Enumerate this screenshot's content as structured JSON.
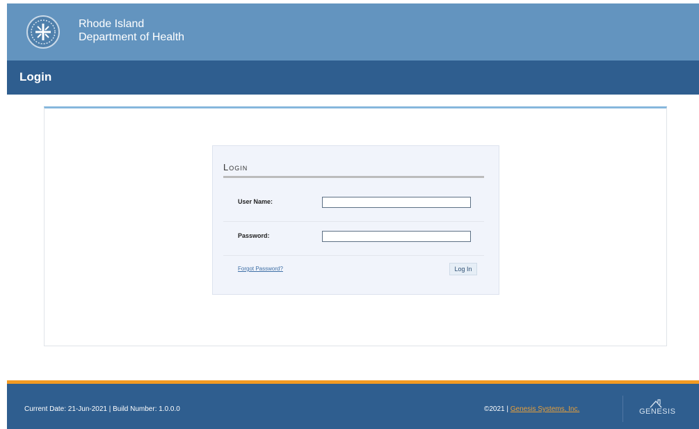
{
  "header": {
    "org_line1": "Rhode Island",
    "org_line2": "Department of Health"
  },
  "page_title": "Login",
  "login_form": {
    "heading": "Login",
    "username_label": "User Name:",
    "username_value": "",
    "password_label": "Password:",
    "password_value": "",
    "forgot_link": "Forgot Password?",
    "submit_label": "Log In"
  },
  "footer": {
    "info": "Current Date: 21-Jun-2021 | Build Number: 1.0.0.0",
    "copyright": "©2021 | ",
    "company_link": "Genesis Systems, Inc.",
    "brand": "GENESIS"
  },
  "colors": {
    "header_bg": "#6394bf",
    "title_bar_bg": "#2f5e8f",
    "footer_accent": "#f39a22",
    "panel_accent": "#86b7dc"
  },
  "icons": [
    "ri-doh-seal-icon",
    "genesis-logo-icon"
  ]
}
